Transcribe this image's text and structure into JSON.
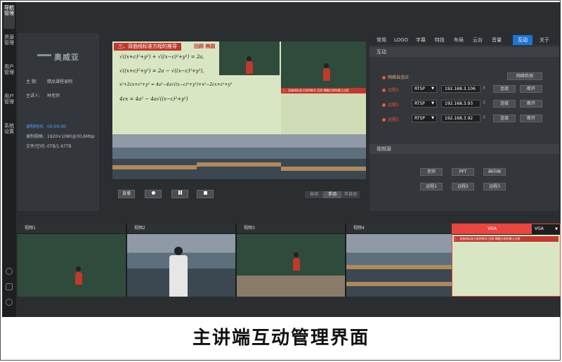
{
  "nav": {
    "items": [
      {
        "label": "导航管理"
      },
      {
        "label": "资源管理"
      },
      {
        "label": "用户管理"
      },
      {
        "label": "用户管理"
      },
      {
        "label": "系统设置"
      }
    ]
  },
  "info": {
    "logo": "奥威亚",
    "topic_key": "主 题:",
    "topic_val": "精品课程录制",
    "speaker_key": "主讲人:",
    "speaker_val": "林老师",
    "rec_time_key": "录制时间:",
    "rec_time_val": "00:00:00",
    "rec_res_key": "录制规格:",
    "rec_res_val": "1920×1080@30,6Mbp",
    "file_key": "文件/空间:",
    "file_val": "0TB/1.67TB"
  },
  "preview": {
    "slide_title": "三、双曲线标准方程的推导",
    "slide_tag": "回顾  椭圆",
    "equations": [
      "√((x+c)²+y²) + √((x−c)²+y²) = 2a,",
      "√((x+c)²+y²) = 2a − √((x−c)²+y²),",
      "x²+2cx+c²+y² = 4a²−4a√((x−c)²+y²)+x²−2cx+c²+y²",
      "4cx = 4a² − 4a√((x−c)²+y²)"
    ],
    "pip_title": "三、双曲线标准方程的推导  回顾  椭圆方程的建立过程"
  },
  "controls": {
    "director_label": "直播",
    "auto_label": "自动",
    "manual_label": "手动",
    "semi_label": "半自动"
  },
  "tabs": [
    "常用",
    "LOGO",
    "字幕",
    "特技",
    "布局",
    "云台",
    "音量",
    "互动",
    "关于"
  ],
  "active_tab": "互动",
  "interact": {
    "section_title": "互动",
    "network_adaptive": "网络自适应",
    "network_test": "网络检测",
    "remotes": [
      {
        "label": "远程1",
        "protocol": "RTSP",
        "ip": "192.168.3.106",
        "connect": "连接",
        "disconnect": "断开"
      },
      {
        "label": "远程2",
        "protocol": "RTSP",
        "ip": "192.168.3.93",
        "connect": "连接",
        "disconnect": "断开"
      },
      {
        "label": "远程3",
        "protocol": "RTSP",
        "ip": "192.168.3.92",
        "connect": "连接",
        "disconnect": "断开"
      }
    ],
    "sources_title": "视频源",
    "sources": [
      "老师",
      "PPT",
      "画中画",
      "远程1",
      "远程2",
      "远程3"
    ]
  },
  "strip": {
    "tiles": [
      {
        "label": "视频1"
      },
      {
        "label": "视频2"
      },
      {
        "label": "视频3"
      },
      {
        "label": "视频4"
      },
      {
        "label": "VGA"
      }
    ],
    "vga_select": "VGA"
  },
  "caption": "主讲端互动管理界面",
  "colors": {
    "accent": "#1e74d6",
    "alert": "#e8463e",
    "background": "#2b2e31"
  }
}
